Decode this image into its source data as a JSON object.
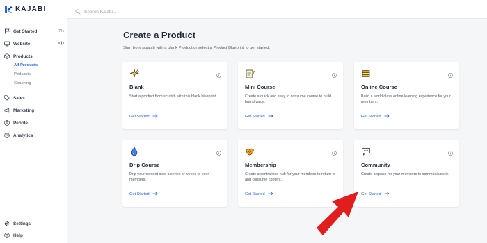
{
  "brand": {
    "name": "KAJABI"
  },
  "search": {
    "placeholder": "Search Kajabi..."
  },
  "sidebar": {
    "items": [
      {
        "label": "Get Started",
        "badge": "7%",
        "icon": "flag-icon"
      },
      {
        "label": "Website",
        "icon": "monitor-icon"
      },
      {
        "label": "Products",
        "icon": "box-icon"
      },
      {
        "label": "Sales",
        "icon": "tag-icon"
      },
      {
        "label": "Marketing",
        "icon": "megaphone-icon"
      },
      {
        "label": "People",
        "icon": "person-icon"
      },
      {
        "label": "Analytics",
        "icon": "chart-icon"
      }
    ],
    "products_sub": [
      "All Products",
      "Podcasts",
      "Coaching"
    ],
    "bottom": [
      {
        "label": "Settings",
        "icon": "gear-icon"
      },
      {
        "label": "Help",
        "icon": "help-icon"
      }
    ]
  },
  "main": {
    "title": "Create a Product",
    "subtitle": "Start from scratch with a blank Product or select a Product Blueprint to get started.",
    "cards": [
      {
        "title": "Blank",
        "desc": "Start a product from scratch with this blank blueprint.",
        "cta": "Get Started",
        "icon": "sparkle-icon"
      },
      {
        "title": "Mini Course",
        "desc": "Create a quick and easy to consume course to build brand value.",
        "cta": "Get Started",
        "icon": "notepad-icon"
      },
      {
        "title": "Online Course",
        "desc": "Build a world class online learning experience for your members.",
        "cta": "Get Started",
        "icon": "books-icon"
      },
      {
        "title": "Drip Course",
        "desc": "Drip your content over a series of weeks to your members.",
        "cta": "Get Started",
        "icon": "droplet-icon"
      },
      {
        "title": "Membership",
        "desc": "Create a centralized hub for your members to return to and consume content.",
        "cta": "Get Started",
        "icon": "handshake-icon"
      },
      {
        "title": "Community",
        "desc": "Create a space for your members to communicate in.",
        "cta": "Get Started",
        "icon": "chat-icon"
      }
    ]
  },
  "colors": {
    "accent": "#2563eb",
    "annotation_arrow": "#e11d1d"
  }
}
